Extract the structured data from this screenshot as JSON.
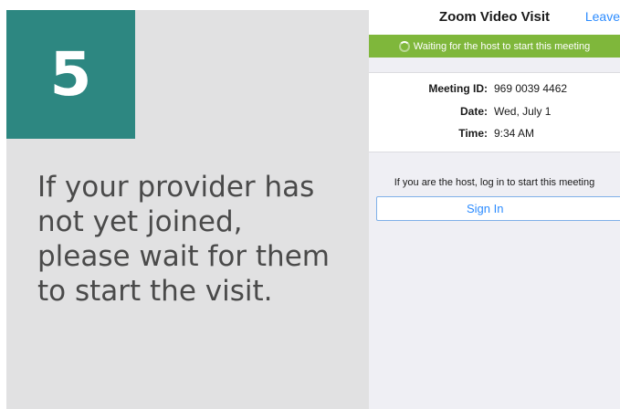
{
  "instruction_panel": {
    "step_number": "5",
    "text": "If your provider has not yet joined, please wait for them to start the visit."
  },
  "app": {
    "title": "Zoom Video Visit",
    "leave_label": "Leave",
    "status_text": "Waiting for the host to start this meeting",
    "details": {
      "meeting_id_label": "Meeting ID:",
      "meeting_id_value": "969 0039 4462",
      "date_label": "Date:",
      "date_value": "Wed, July 1",
      "time_label": "Time:",
      "time_value": "9:34 AM"
    },
    "host_prompt": "If you are the host, log in to start this meeting",
    "sign_in_label": "Sign In"
  },
  "colors": {
    "step_box": "#2d8781",
    "panel_bg": "#e1e1e2",
    "status_bar": "#7fb73b",
    "link_blue": "#2d8cff"
  },
  "icons": {
    "status_spinner": "loading-spinner-icon"
  }
}
